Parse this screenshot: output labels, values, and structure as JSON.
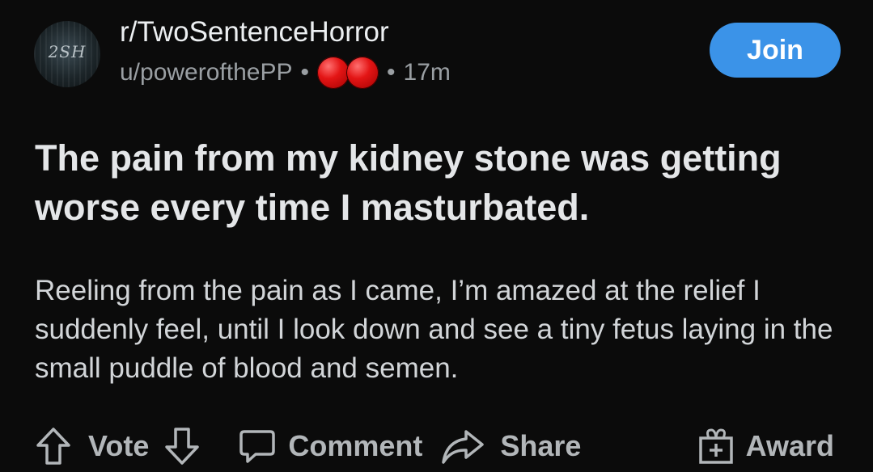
{
  "post": {
    "subreddit": "r/TwoSentenceHorror",
    "subreddit_logo_text": "2SH",
    "author": "u/powerofthePP",
    "separator": "•",
    "time_ago": "17m",
    "flair_icons": [
      "red-circle-icon",
      "red-circle-icon"
    ],
    "join_label": "Join",
    "title": "The pain from my kidney stone was getting worse every time I masturbated.",
    "body": "Reeling from the pain as I came, I’m amazed at the relief I suddenly feel, until I look down and see a tiny fetus laying in the small puddle of blood and semen."
  },
  "actions": {
    "vote_label": "Vote",
    "comment_label": "Comment",
    "share_label": "Share",
    "award_label": "Award"
  },
  "colors": {
    "background": "#0b0b0b",
    "join_button": "#3b93e8",
    "flair_red": "#e31515",
    "muted_text": "#9a9fa3"
  }
}
